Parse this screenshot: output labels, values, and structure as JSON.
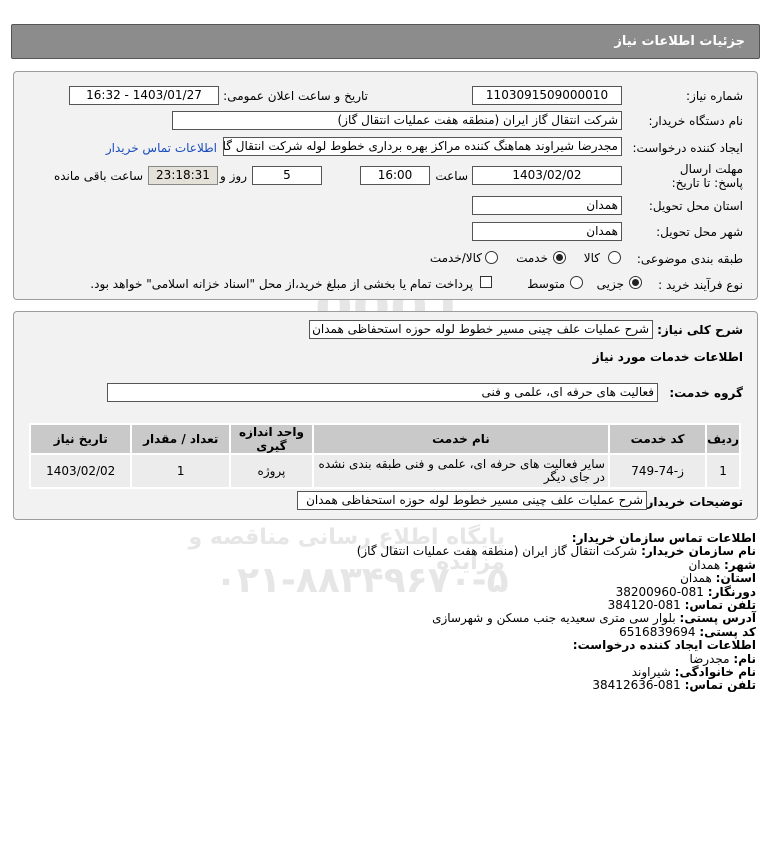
{
  "header": {
    "title": "جزئیات اطلاعات نیاز"
  },
  "form": {
    "need_number_label": "شماره نیاز:",
    "need_number": "1103091509000010",
    "announce_label": "تاریخ و ساعت اعلان عمومی:",
    "announce_value": "1403/01/27 - 16:32",
    "buyer_org_label": "نام دستگاه خریدار:",
    "buyer_org": "شرکت انتقال گاز ایران (منطقه هفت عملیات انتقال گاز)",
    "requester_label": "ایجاد کننده درخواست:",
    "requester": "مجدرضا شیراوند هماهنگ کننده مراکز بهره برداری خطوط لوله  شرکت انتقال گاز",
    "contact_link": "اطلاعات تماس خریدار",
    "deadline_label": "مهلت ارسال پاسخ: تا تاریخ:",
    "deadline_date": "1403/02/02",
    "time_label": "ساعت",
    "deadline_time": "16:00",
    "days_value": "5",
    "days_label": "روز و",
    "remaining_time": "23:18:31",
    "remaining_label": "ساعت باقی مانده",
    "province_label": "استان محل تحویل:",
    "province": "همدان",
    "city_label": "شهر محل تحویل:",
    "city": "همدان",
    "category_label": "طبقه بندی موضوعی:",
    "category_options": [
      "کالا",
      "خدمت",
      "کالا/خدمت"
    ],
    "category_selected": "خدمت",
    "process_label": "نوع فرآیند خرید :",
    "process_options": [
      "جزیی",
      "متوسط"
    ],
    "process_selected": "جزیی",
    "treasury_note": "پرداخت تمام یا بخشی از مبلغ خرید،از محل \"اسناد خزانه اسلامی\" خواهد بود."
  },
  "need": {
    "summary_label": "شرح کلی نیاز:",
    "summary": "شرح عملیات علف چینی مسیر خطوط لوله حوزه استحفاظی همدان",
    "services_title": "اطلاعات خدمات مورد نیاز",
    "service_group_label": "گروه خدمت:",
    "service_group": "فعالیت های حرفه ای، علمی و فنی",
    "table": {
      "headers": [
        "ردیف",
        "کد خدمت",
        "نام خدمت",
        "واحد اندازه گیری",
        "تعداد / مقدار",
        "تاریخ نیاز"
      ],
      "rows": [
        [
          "1",
          "ز-74-749",
          "سایر فعالیت های حرفه ای، علمی و فنی طبقه بندی نشده در جای دیگر",
          "پروژه",
          "1",
          "1403/02/02"
        ]
      ]
    },
    "buyer_notes_label": "توضیحات خریدار:",
    "buyer_notes": "شرح عملیات علف چینی مسیر خطوط لوله حوزه استحفاظی همدان"
  },
  "contact": {
    "title": "اطلاعات تماس سازمان خریدار:",
    "org_label": "نام سازمان خریدار:",
    "org": "شرکت انتقال گاز ایران (منطقه هفت عملیات انتقال گاز)",
    "city_label": "شهر:",
    "city": "همدان",
    "province_label": "استان:",
    "province": "همدان",
    "fax_label": "دورنگار:",
    "fax": "081-38200960",
    "phone_label": "تلفن تماس:",
    "phone": "081-384120",
    "address_label": "آدرس پستی:",
    "address": "بلوار سی متری سعیدیه جنب مسکن و شهرسازی",
    "postal_label": "کد پستی:",
    "postal": "6516839694",
    "creator_title": "اطلاعات ایجاد کننده درخواست:",
    "name_label": "نام:",
    "name": "مجدرضا",
    "family_label": "نام خانوادگی:",
    "family": "شیراوند",
    "creator_phone_label": "تلفن تماس:",
    "creator_phone": "081-38412636"
  },
  "watermark": {
    "line1": "0101",
    "line2": "0001",
    "site": "ParsNamadData",
    "fa1": "پایگاه اطلاع رسانی مناقصه و مزایده",
    "phone": "۰۲۱-۸۸۳۴۹۶۷۰-۵"
  }
}
